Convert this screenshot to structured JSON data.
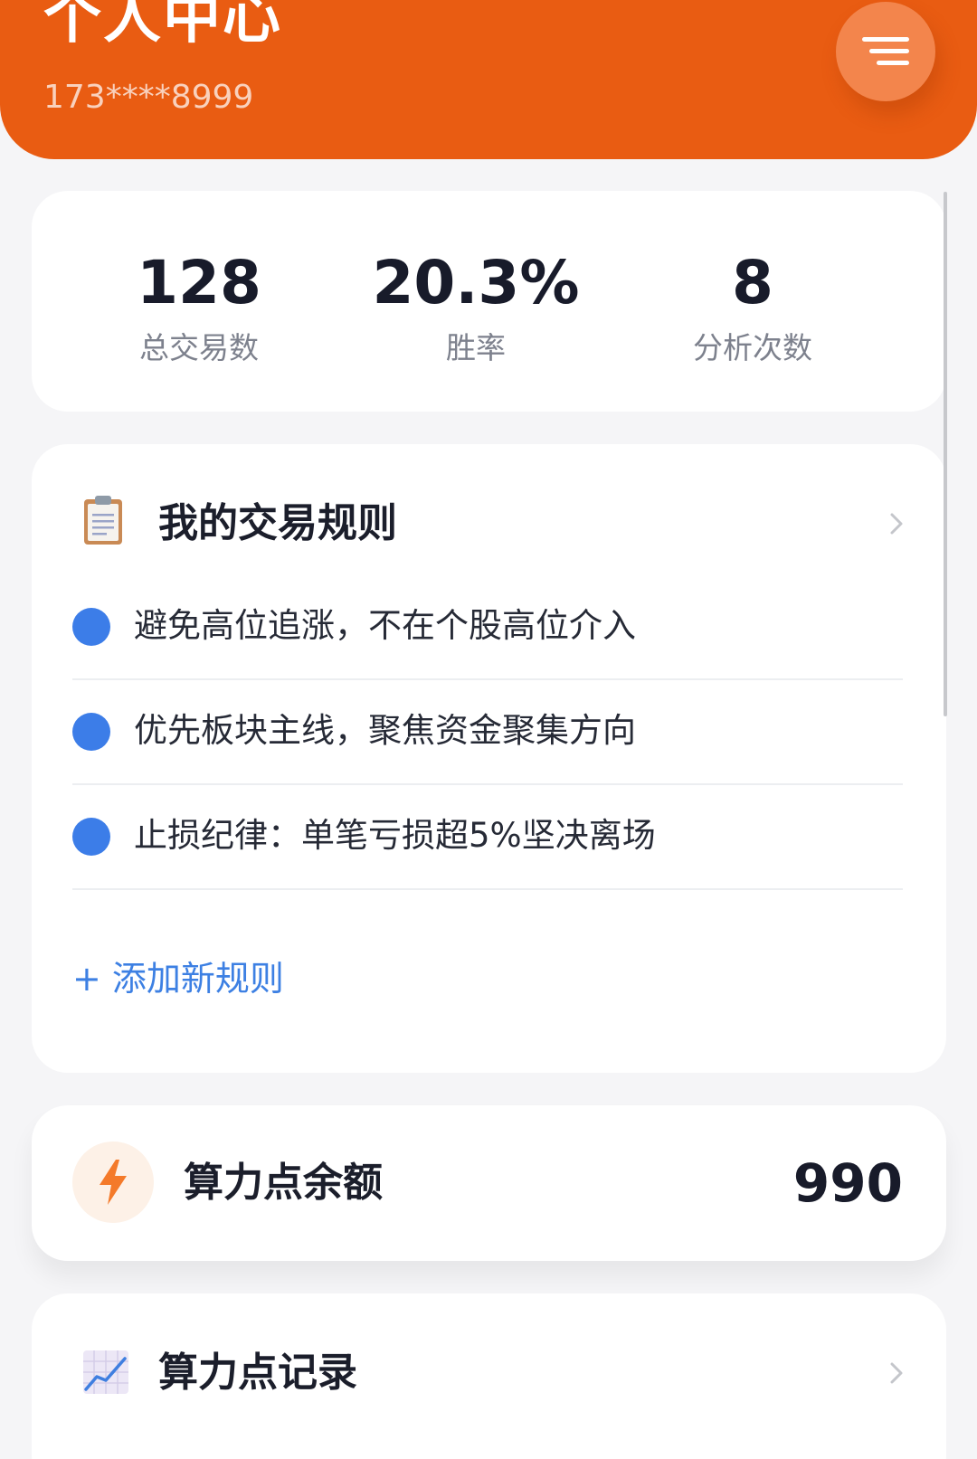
{
  "header": {
    "title": "个人中心",
    "phone": "173****8999",
    "menu_icon": "menu-icon",
    "background": "#e95c12"
  },
  "stats": [
    {
      "value": "128",
      "label": "总交易数"
    },
    {
      "value": "20.3%",
      "label": "胜率"
    },
    {
      "value": "8",
      "label": "分析次数"
    }
  ],
  "rules": {
    "icon": "clipboard-icon",
    "title": "我的交易规则",
    "items": [
      {
        "text": "避免高位追涨，不在个股高位介入"
      },
      {
        "text": "优先板块主线，聚焦资金聚集方向"
      },
      {
        "text": "止损纪律：单笔亏损超5%坚决离场"
      }
    ],
    "bullet_color": "#3c7de8",
    "add_label": "+ 添加新规则",
    "add_color": "#3d80e3"
  },
  "balance": {
    "icon": "lightning-icon",
    "label": "算力点余额",
    "value": "990"
  },
  "records": {
    "icon": "chart-trend-icon",
    "title": "算力点记录"
  }
}
